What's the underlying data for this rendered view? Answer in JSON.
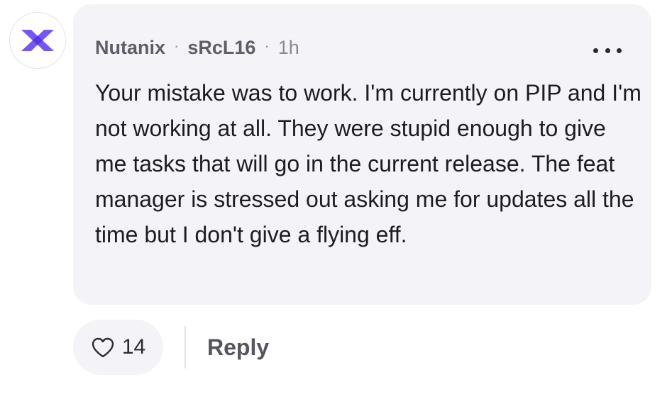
{
  "comment": {
    "company": "Nutanix",
    "username": "sRcL16",
    "time": "1h",
    "separator": "·",
    "text": "Your mistake was to work. I'm currently on PIP and I'm not working at all. They were stupid enough to give me tasks that will go in the current release. The feat manager is stressed out asking me for updates all the time but I don't give a flying eff.",
    "more_icon": "more-horizontal-icon"
  },
  "avatar": {
    "icon": "nutanix-logo",
    "color": "#7855fa"
  },
  "actions": {
    "like_icon": "heart-outline-icon",
    "like_count": "14",
    "reply_label": "Reply"
  }
}
